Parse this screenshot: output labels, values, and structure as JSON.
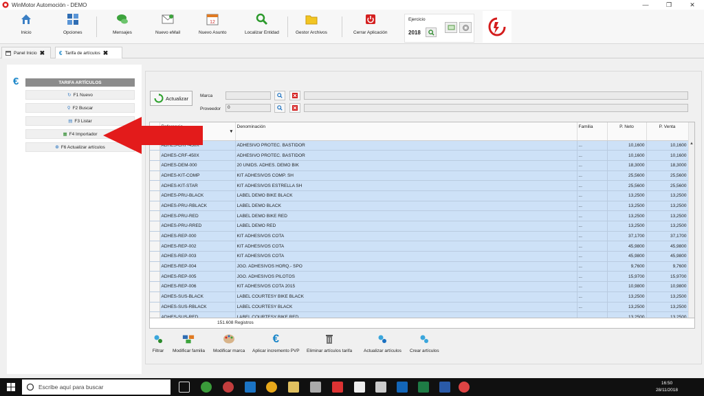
{
  "window": {
    "title": "WinMotor Automoción - DEMO"
  },
  "toolbar": {
    "items": [
      {
        "label": "Inicio",
        "icon": "home-icon"
      },
      {
        "label": "Opciones",
        "icon": "cubes-icon"
      },
      {
        "label": "Mensajes",
        "icon": "chat-icon"
      },
      {
        "label": "Nuevo eMail",
        "icon": "email-icon"
      },
      {
        "label": "Nuevo Asunto",
        "icon": "calendar-icon"
      },
      {
        "label": "Localizar Entidad",
        "icon": "search-icon"
      },
      {
        "label": "Gestor Archivos",
        "icon": "folder-icon"
      },
      {
        "label": "Cerrar Aplicación",
        "icon": "power-icon"
      }
    ],
    "ejercicio_label": "Ejercicio",
    "ejercicio_year": "2018"
  },
  "tabs": [
    {
      "label": "Panel Inicio"
    },
    {
      "label": "Tarifa de artículos"
    }
  ],
  "left_panel": {
    "header": "TARIFA ARTÍCULOS",
    "buttons": [
      {
        "label": "F1 Nuevo"
      },
      {
        "label": "F2 Buscar"
      },
      {
        "label": "F3 Listar"
      },
      {
        "label": "F4 Importador"
      },
      {
        "label": "F6 Actualizar artículos"
      }
    ]
  },
  "filters": {
    "refresh_label": "Actualizar",
    "marca_label": "Marca",
    "marca_value": "",
    "proveedor_label": "Proveedor",
    "proveedor_value": "0"
  },
  "grid": {
    "columns": [
      "Referencia",
      "Denominación",
      "Familia",
      "P. Neto",
      "P. Venta"
    ],
    "rows": [
      [
        "ADHES-CRF-450X",
        "ADHESIVO PROTEC. BASTIDOR",
        "...",
        "10,1600",
        "10,1600"
      ],
      [
        "ADHES-CRF-450X",
        "ADHESIVO PROTEC. BASTIDOR",
        "...",
        "10,1600",
        "10,1600"
      ],
      [
        "ADHES-DEM-000",
        "20 UNIDS. ADHES. DEMO BIK",
        "...",
        "18,3000",
        "18,3000"
      ],
      [
        "ADHES-KIT-COMP",
        "KIT ADHESIVOS COMP. SH",
        "...",
        "25,5600",
        "25,5600"
      ],
      [
        "ADHES-KIT-STAR",
        "KIT ADHESIVOS ESTRELLA SH",
        "...",
        "25,5600",
        "25,5600"
      ],
      [
        "ADHES-PRU-BLACK",
        "LABEL DEMO BIKE BLACK",
        "...",
        "13,2500",
        "13,2500"
      ],
      [
        "ADHES-PRU-RBLACK",
        "LABEL DEMO BLACK",
        "...",
        "13,2500",
        "13,2500"
      ],
      [
        "ADHES-PRU-RED",
        "LABEL DEMO BIKE RED",
        "...",
        "13,2500",
        "13,2500"
      ],
      [
        "ADHES-PRU-RRED",
        "LABEL DEMO RED",
        "...",
        "13,2500",
        "13,2500"
      ],
      [
        "ADHES-REP-000",
        "KIT ADHESIVOS COTA",
        "...",
        "37,1700",
        "37,1700"
      ],
      [
        "ADHES-REP-002",
        "KIT ADHESIVOS COTA",
        "...",
        "45,9800",
        "45,9800"
      ],
      [
        "ADHES-REP-003",
        "KIT ADHESIVOS COTA",
        "...",
        "45,9800",
        "45,9800"
      ],
      [
        "ADHES-REP-004",
        "JGO. ADHESIVOS HORQ.- SPO",
        "...",
        "9,7600",
        "9,7600"
      ],
      [
        "ADHES-REP-005",
        "JGO. ADHESIVOS PILOTOS",
        "...",
        "15,9700",
        "15,9700"
      ],
      [
        "ADHES-REP-006",
        "KIT ADHESIVOS COTA 2015",
        "...",
        "10,9800",
        "10,9800"
      ],
      [
        "ADHES-SUS-BLACK",
        "LABEL COURTESY BIKE BLACK",
        "...",
        "13,2500",
        "13,2500"
      ],
      [
        "ADHES-SUS-RBLACK",
        "LABEL COURTESY BLACK",
        "...",
        "13,2500",
        "13,2500"
      ],
      [
        "ADHES-SUS-RED",
        "LABEL COURTESY BIKE RED",
        "...",
        "13,2500",
        "13,2500"
      ]
    ],
    "record_count": "151.608 Registros"
  },
  "actions": [
    {
      "label": "Filtrar",
      "icon": "filter-gears-icon"
    },
    {
      "label": "Modificar familia",
      "icon": "family-icon"
    },
    {
      "label": "Modificar marca",
      "icon": "palette-icon"
    },
    {
      "label": "Aplicar incremento PVP",
      "icon": "euro-icon"
    },
    {
      "label": "Eliminar artículos tarifa",
      "icon": "trash-icon"
    },
    {
      "label": "Actualizar artículos",
      "icon": "gears-icon"
    },
    {
      "label": "Crear artículos",
      "icon": "create-gears-icon"
    }
  ],
  "taskbar": {
    "search_placeholder": "Escribe aquí para buscar",
    "time": "16:50",
    "date": "28/11/2018"
  },
  "colors": {
    "row_fill": "#cde1f7",
    "accent_blue": "#1a86c9",
    "arrow_red": "#e31b1b"
  }
}
